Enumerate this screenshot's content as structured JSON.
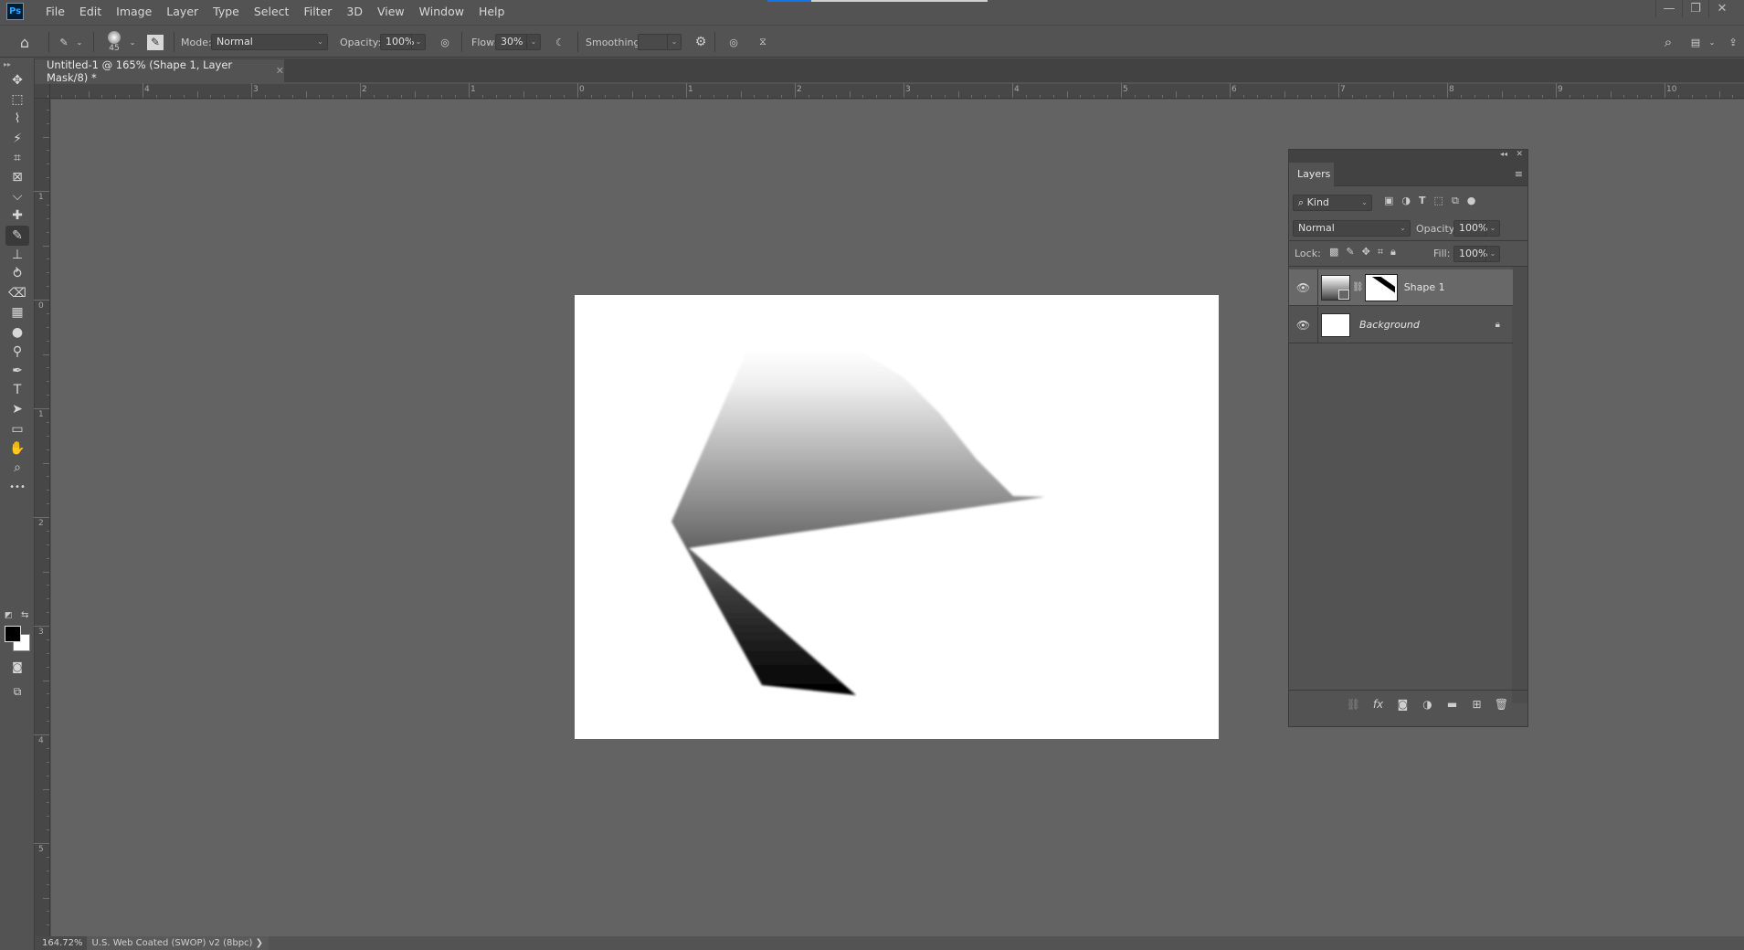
{
  "app": {
    "logo": "Ps",
    "title_progress": 0.2
  },
  "menu": [
    "File",
    "Edit",
    "Image",
    "Layer",
    "Type",
    "Select",
    "Filter",
    "3D",
    "View",
    "Window",
    "Help"
  ],
  "window_controls": {
    "minimize": "—",
    "restore": "❐",
    "close": "✕"
  },
  "options": {
    "brush_size": "45",
    "mode_label": "Mode:",
    "mode_value": "Normal",
    "opacity_label": "Opacity:",
    "opacity_value": "100%",
    "flow_label": "Flow:",
    "flow_value": "30%",
    "smoothing_label": "Smoothing:",
    "smoothing_value": ""
  },
  "document_tab": {
    "title": "Untitled-1 @ 165% (Shape 1, Layer Mask/8) *",
    "close": "✕"
  },
  "rulers": {
    "horizontal_labels": [
      "4",
      "3",
      "2",
      "1",
      "0",
      "1",
      "2",
      "3",
      "4",
      "5",
      "6",
      "7",
      "8",
      "9",
      "10"
    ],
    "vertical_labels": [
      "1",
      "0",
      "1",
      "2",
      "3",
      "4",
      "5"
    ]
  },
  "tools": [
    {
      "name": "move-tool",
      "glyph": "✥"
    },
    {
      "name": "marquee-tool",
      "glyph": "⬚"
    },
    {
      "name": "lasso-tool",
      "glyph": "⌇"
    },
    {
      "name": "magic-wand-tool",
      "glyph": "⚡"
    },
    {
      "name": "crop-tool",
      "glyph": "⌗"
    },
    {
      "name": "frame-tool",
      "glyph": "⊠"
    },
    {
      "name": "eyedropper-tool",
      "glyph": "⌵"
    },
    {
      "name": "healing-brush-tool",
      "glyph": "✚"
    },
    {
      "name": "brush-tool",
      "glyph": "✎",
      "active": true
    },
    {
      "name": "clone-stamp-tool",
      "glyph": "⊥"
    },
    {
      "name": "history-brush-tool",
      "glyph": "⥁"
    },
    {
      "name": "eraser-tool",
      "glyph": "⌫"
    },
    {
      "name": "gradient-tool",
      "glyph": "▦"
    },
    {
      "name": "blur-tool",
      "glyph": "●"
    },
    {
      "name": "dodge-tool",
      "glyph": "⚲"
    },
    {
      "name": "pen-tool",
      "glyph": "✒"
    },
    {
      "name": "type-tool",
      "glyph": "T"
    },
    {
      "name": "path-selection-tool",
      "glyph": "➤"
    },
    {
      "name": "rectangle-tool",
      "glyph": "▭"
    },
    {
      "name": "hand-tool",
      "glyph": "✋"
    },
    {
      "name": "zoom-tool",
      "glyph": "⌕"
    },
    {
      "name": "more-tools",
      "glyph": "•••"
    }
  ],
  "colors": {
    "foreground": "#000000",
    "background": "#ffffff",
    "accent": "#31a8ff"
  },
  "layers_panel": {
    "tab": "Layers",
    "filter_kind": "Kind",
    "blend_mode": "Normal",
    "opacity_label": "Opacity:",
    "opacity_value": "100%",
    "lock_label": "Lock:",
    "fill_label": "Fill:",
    "fill_value": "100%",
    "layers": [
      {
        "name": "Shape 1",
        "visible": true,
        "selected": true,
        "has_mask": true
      },
      {
        "name": "Background",
        "visible": true,
        "locked": true,
        "italic": true
      }
    ]
  },
  "status": {
    "zoom": "164.72%",
    "profile": "U.S. Web Coated (SWOP) v2 (8bpc)",
    "arrow": "❯"
  }
}
